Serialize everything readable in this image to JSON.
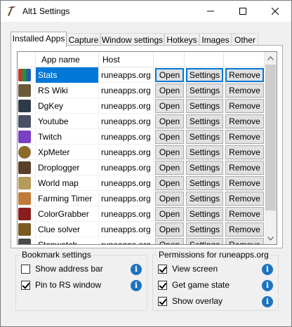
{
  "window": {
    "title": "Alt1 Settings"
  },
  "tabs": [
    {
      "label": "Installed Apps",
      "active": true
    },
    {
      "label": "Capture"
    },
    {
      "label": "Window settings"
    },
    {
      "label": "Hotkeys"
    },
    {
      "label": "Images"
    },
    {
      "label": "Other"
    }
  ],
  "apps_table": {
    "columns": [
      "App name",
      "Host"
    ],
    "rows": [
      {
        "name": "Stats",
        "host": "runeapps.org",
        "icon": "stats-icon",
        "selected": true
      },
      {
        "name": "RS Wiki",
        "host": "runeapps.org",
        "icon": "rs-wiki-icon"
      },
      {
        "name": "DgKey",
        "host": "runeapps.org",
        "icon": "dgkey-icon"
      },
      {
        "name": "Youtube",
        "host": "runeapps.org",
        "icon": "youtube-icon"
      },
      {
        "name": "Twitch",
        "host": "runeapps.org",
        "icon": "twitch-icon"
      },
      {
        "name": "XpMeter",
        "host": "runeapps.org",
        "icon": "xpmeter-icon"
      },
      {
        "name": "Droplogger",
        "host": "runeapps.org",
        "icon": "droplogger-icon"
      },
      {
        "name": "World map",
        "host": "runeapps.org",
        "icon": "world-map-icon"
      },
      {
        "name": "Farming Timer",
        "host": "runeapps.org",
        "icon": "farming-timer-icon"
      },
      {
        "name": "ColorGrabber",
        "host": "runeapps.org",
        "icon": "colorgrabber-icon"
      },
      {
        "name": "Clue solver",
        "host": "runeapps.org",
        "icon": "clue-solver-icon"
      },
      {
        "name": "Stopwatch",
        "host": "runeapps.org",
        "icon": "stopwatch-icon"
      }
    ],
    "buttons": {
      "open": "Open",
      "settings": "Settings",
      "remove": "Remove"
    }
  },
  "bookmark_settings": {
    "title": "Bookmark settings",
    "options": [
      {
        "label": "Show address bar",
        "checked": false
      },
      {
        "label": "Pin to RS window",
        "checked": true
      }
    ]
  },
  "permissions": {
    "title": "Permissions for runeapps.org",
    "options": [
      {
        "label": "View screen",
        "checked": true
      },
      {
        "label": "Get game state",
        "checked": true
      },
      {
        "label": "Show overlay",
        "checked": true
      }
    ]
  },
  "colors": {
    "selection": "#0078d7",
    "info": "#1e73be"
  }
}
